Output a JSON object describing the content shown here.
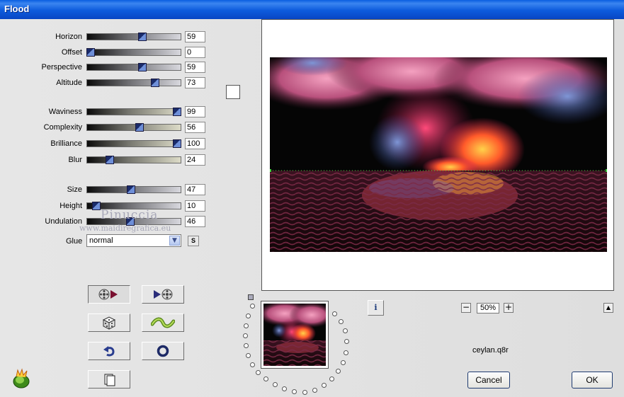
{
  "window": {
    "title": "Flood"
  },
  "sliders": [
    {
      "label": "Horizon",
      "value": "59",
      "level": 0.59
    },
    {
      "label": "Offset",
      "value": "0",
      "level": 0.0
    },
    {
      "label": "Perspective",
      "value": "59",
      "level": 0.59
    },
    {
      "label": "Altitude",
      "value": "73",
      "level": 0.73
    },
    {
      "label": "Waviness",
      "value": "99",
      "level": 0.99
    },
    {
      "label": "Complexity",
      "value": "56",
      "level": 0.56
    },
    {
      "label": "Brilliance",
      "value": "100",
      "level": 1.0
    },
    {
      "label": "Blur",
      "value": "24",
      "level": 0.24
    },
    {
      "label": "Size",
      "value": "47",
      "level": 0.47
    },
    {
      "label": "Height",
      "value": "10",
      "level": 0.1
    },
    {
      "label": "Undulation",
      "value": "46",
      "level": 0.46
    }
  ],
  "watermark": {
    "name": "Pinuccia",
    "url": "www.maidiregrafica.eu"
  },
  "glue": {
    "label": "Glue",
    "value": "normal",
    "s_button": "S"
  },
  "toolbar": [
    "preview-play",
    "play-preview",
    "random",
    "wave",
    "undo",
    "reset",
    "copy"
  ],
  "zoom": {
    "value": "50%",
    "minus": "−",
    "plus": "+"
  },
  "info_label": "i",
  "filename": "ceylan.q8r",
  "buttons": {
    "cancel": "Cancel",
    "ok": "OK"
  },
  "colors": {
    "titlebar": "#0a5ee0",
    "accent": "#1f3b70",
    "horizon_marker": "#3fd23f"
  }
}
